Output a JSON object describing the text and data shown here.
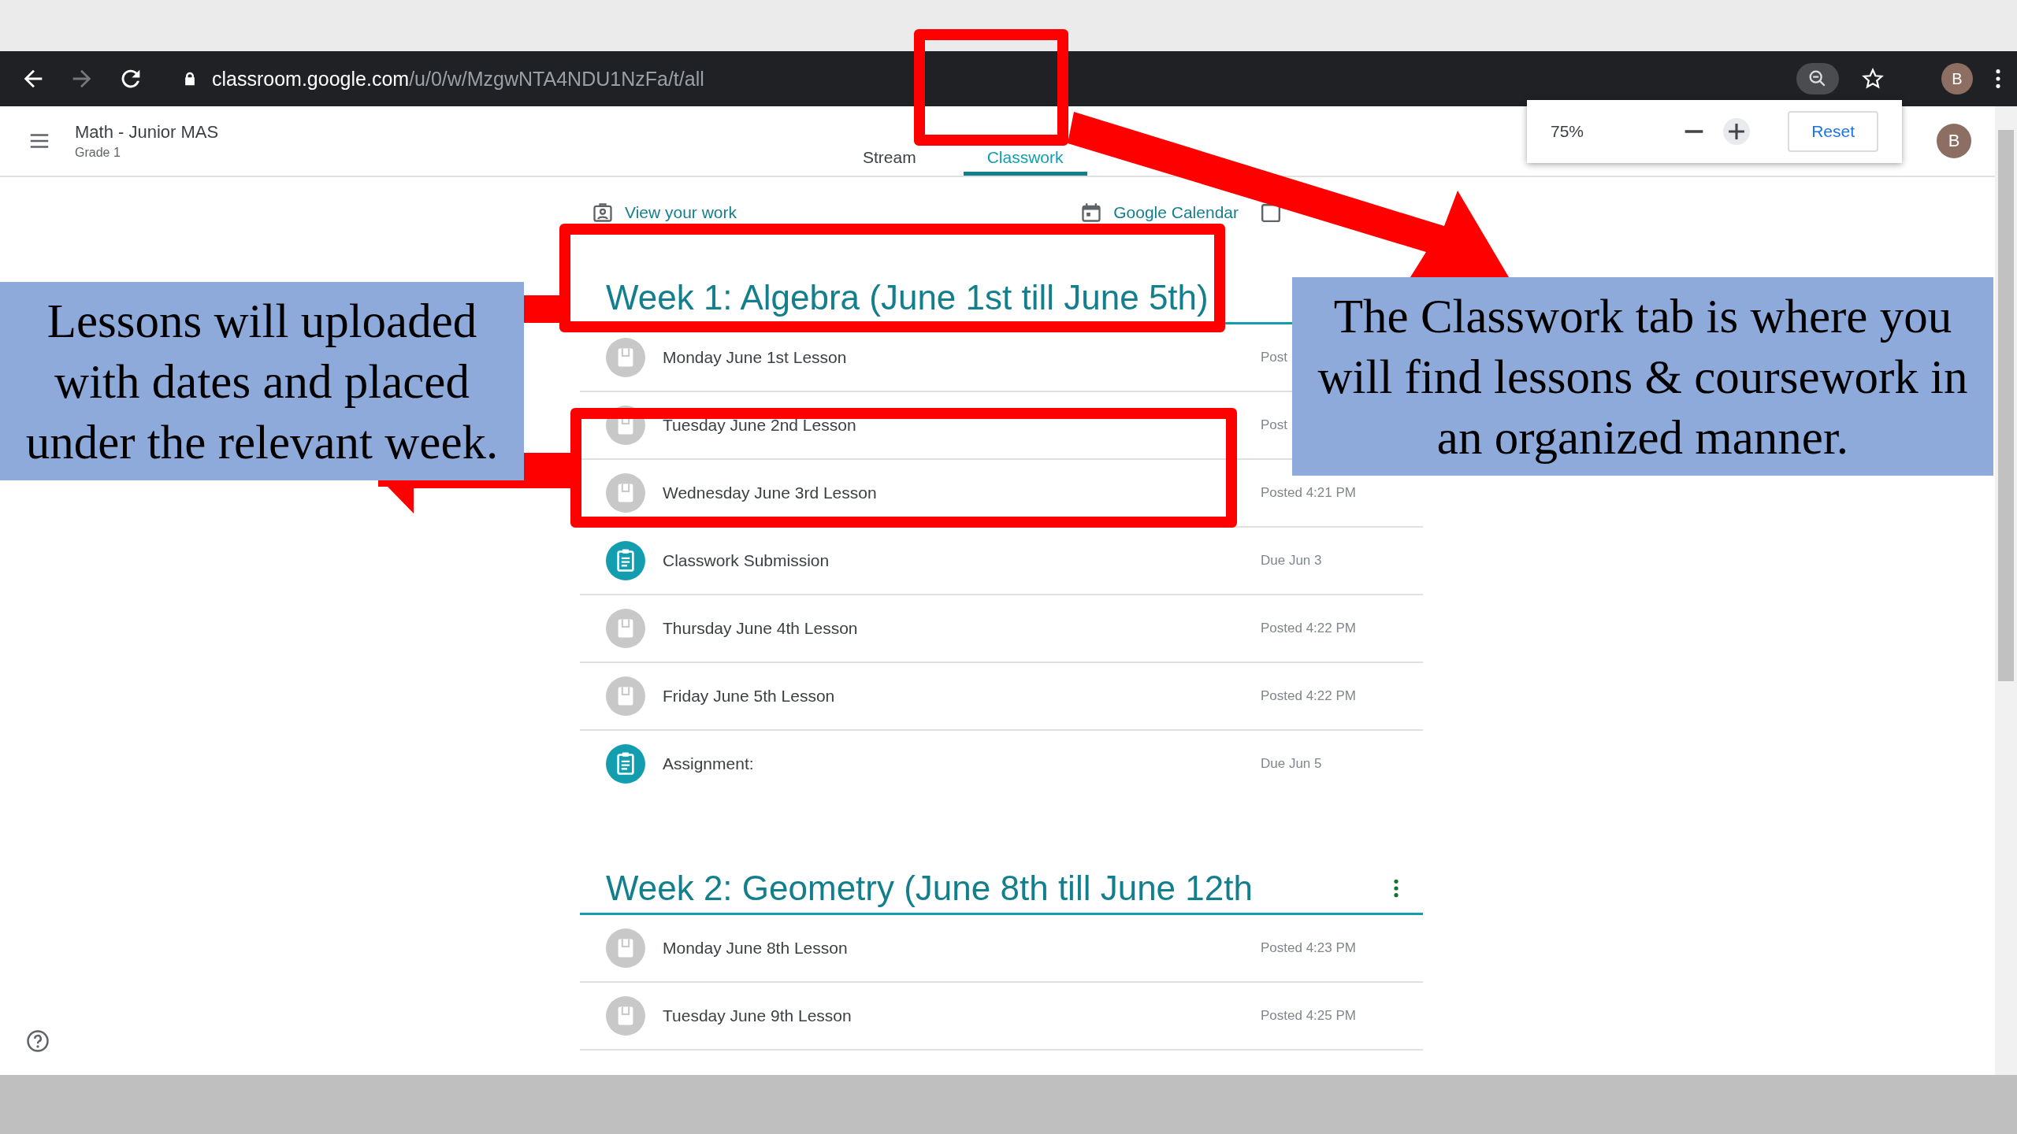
{
  "browser": {
    "url_host": "classroom.google.com",
    "url_path": "/u/0/w/MzgwNTA4NDU1NzFa/t/all",
    "profile_initial": "B"
  },
  "zoom_popup": {
    "level_text": "75%",
    "reset": "Reset"
  },
  "header": {
    "course": "Math - Junior MAS",
    "section": "Grade 1",
    "avatar_initial": "B"
  },
  "tabs": [
    {
      "label": "Stream",
      "selected": false
    },
    {
      "label": "Classwork",
      "selected": true
    }
  ],
  "links": [
    {
      "kind": "work",
      "label": "View your work"
    },
    {
      "kind": "calendar",
      "label": "Google Calendar"
    }
  ],
  "topics": [
    {
      "title": "Week 1: Algebra (June 1st till June 5th)",
      "items": [
        {
          "kind": "material",
          "title": "Monday June 1st Lesson",
          "meta": "Post"
        },
        {
          "kind": "material",
          "title": "Tuesday June 2nd Lesson",
          "meta": "Post"
        },
        {
          "kind": "material",
          "title": "Wednesday June 3rd Lesson",
          "meta": "Posted 4:21 PM"
        },
        {
          "kind": "assignment",
          "title": "Classwork Submission",
          "meta": "Due Jun 3"
        },
        {
          "kind": "material",
          "title": "Thursday June 4th Lesson",
          "meta": "Posted 4:22 PM"
        },
        {
          "kind": "material",
          "title": "Friday June 5th Lesson",
          "meta": "Posted 4:22 PM"
        },
        {
          "kind": "assignment",
          "title": "Assignment:",
          "meta": "Due Jun 5"
        }
      ]
    },
    {
      "title": "Week 2: Geometry (June 8th till June 12th",
      "menu": true,
      "items": [
        {
          "kind": "material",
          "title": "Monday June 8th Lesson",
          "meta": "Posted 4:23 PM"
        },
        {
          "kind": "material",
          "title": "Tuesday June 9th Lesson",
          "meta": "Posted 4:25 PM"
        }
      ]
    }
  ],
  "callouts": [
    {
      "text": "Lessons will uploaded with dates and placed under the relevant week."
    },
    {
      "text": "The Classwork tab is where you will find lessons & coursework in an organized manner."
    }
  ]
}
